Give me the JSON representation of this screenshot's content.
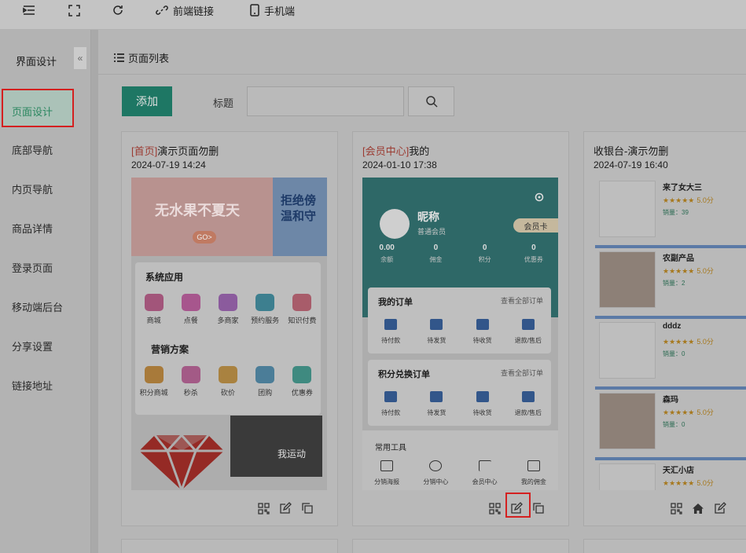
{
  "topbar": {
    "frontend_link": "前端链接",
    "mobile": "手机端"
  },
  "sidebar": {
    "title": "界面设计",
    "collapse": "«",
    "items": [
      {
        "label": "页面设计"
      },
      {
        "label": "底部导航"
      },
      {
        "label": "内页导航"
      },
      {
        "label": "商品详情"
      },
      {
        "label": "登录页面"
      },
      {
        "label": "移动端后台"
      },
      {
        "label": "分享设置"
      },
      {
        "label": "链接地址"
      }
    ]
  },
  "page_list": {
    "title": "页面列表",
    "add_label": "添加",
    "title_label": "标题",
    "title_value": ""
  },
  "cards": [
    {
      "tag": "[首页]",
      "name": "演示页面勿删",
      "date": "2024-07-19 14:24",
      "banner_text": "无水果不夏天",
      "banner_go": "GO>",
      "banner_right": "拒绝傍温和守",
      "sections": [
        {
          "title": "系统应用",
          "items": [
            "商城",
            "点餐",
            "多商家",
            "预约服务",
            "知识付费"
          ]
        },
        {
          "title": "营销方案",
          "items": [
            "积分商城",
            "秒杀",
            "砍价",
            "团购",
            "优惠券"
          ]
        }
      ],
      "sports_text": "我运动"
    },
    {
      "tag": "[会员中心]",
      "name": "我的",
      "date": "2024-01-10 17:38",
      "nickname": "昵称",
      "level": "普通会员",
      "member_card": "会员卡",
      "stats": [
        {
          "value": "0.00",
          "label": "余额"
        },
        {
          "value": "0",
          "label": "佣金"
        },
        {
          "value": "0",
          "label": "积分"
        },
        {
          "value": "0",
          "label": "优惠券"
        }
      ],
      "orders": {
        "title": "我的订单",
        "more": "查看全部订单",
        "items": [
          "待付款",
          "待发货",
          "待收货",
          "退款/售后"
        ]
      },
      "points_orders": {
        "title": "积分兑换订单",
        "more": "查看全部订单",
        "items": [
          "待付款",
          "待发货",
          "待收货",
          "退款/售后"
        ]
      },
      "tools": {
        "title": "常用工具",
        "items": [
          "分销海报",
          "分销中心",
          "会员中心",
          "我的佣金"
        ]
      }
    },
    {
      "tag": "",
      "name": "收银台-演示勿删",
      "date": "2024-07-19 16:40",
      "products": [
        {
          "name": "来了女大三",
          "rating": "5.0分",
          "sales_label": "销量：",
          "sales": "39"
        },
        {
          "name": "农副产品",
          "rating": "5.0分",
          "sales_label": "销量：",
          "sales": "2"
        },
        {
          "name": "dddz",
          "rating": "5.0分",
          "sales_label": "销量：",
          "sales": "0"
        },
        {
          "name": "森玛",
          "rating": "5.0分",
          "sales_label": "销量：",
          "sales": "0"
        },
        {
          "name": "天汇小店",
          "rating": "5.0分",
          "sales_label": "",
          "sales": ""
        }
      ]
    }
  ],
  "colors": {
    "accent": "#1e7764",
    "active_text": "#2b8760",
    "highlight": "#d42020"
  }
}
